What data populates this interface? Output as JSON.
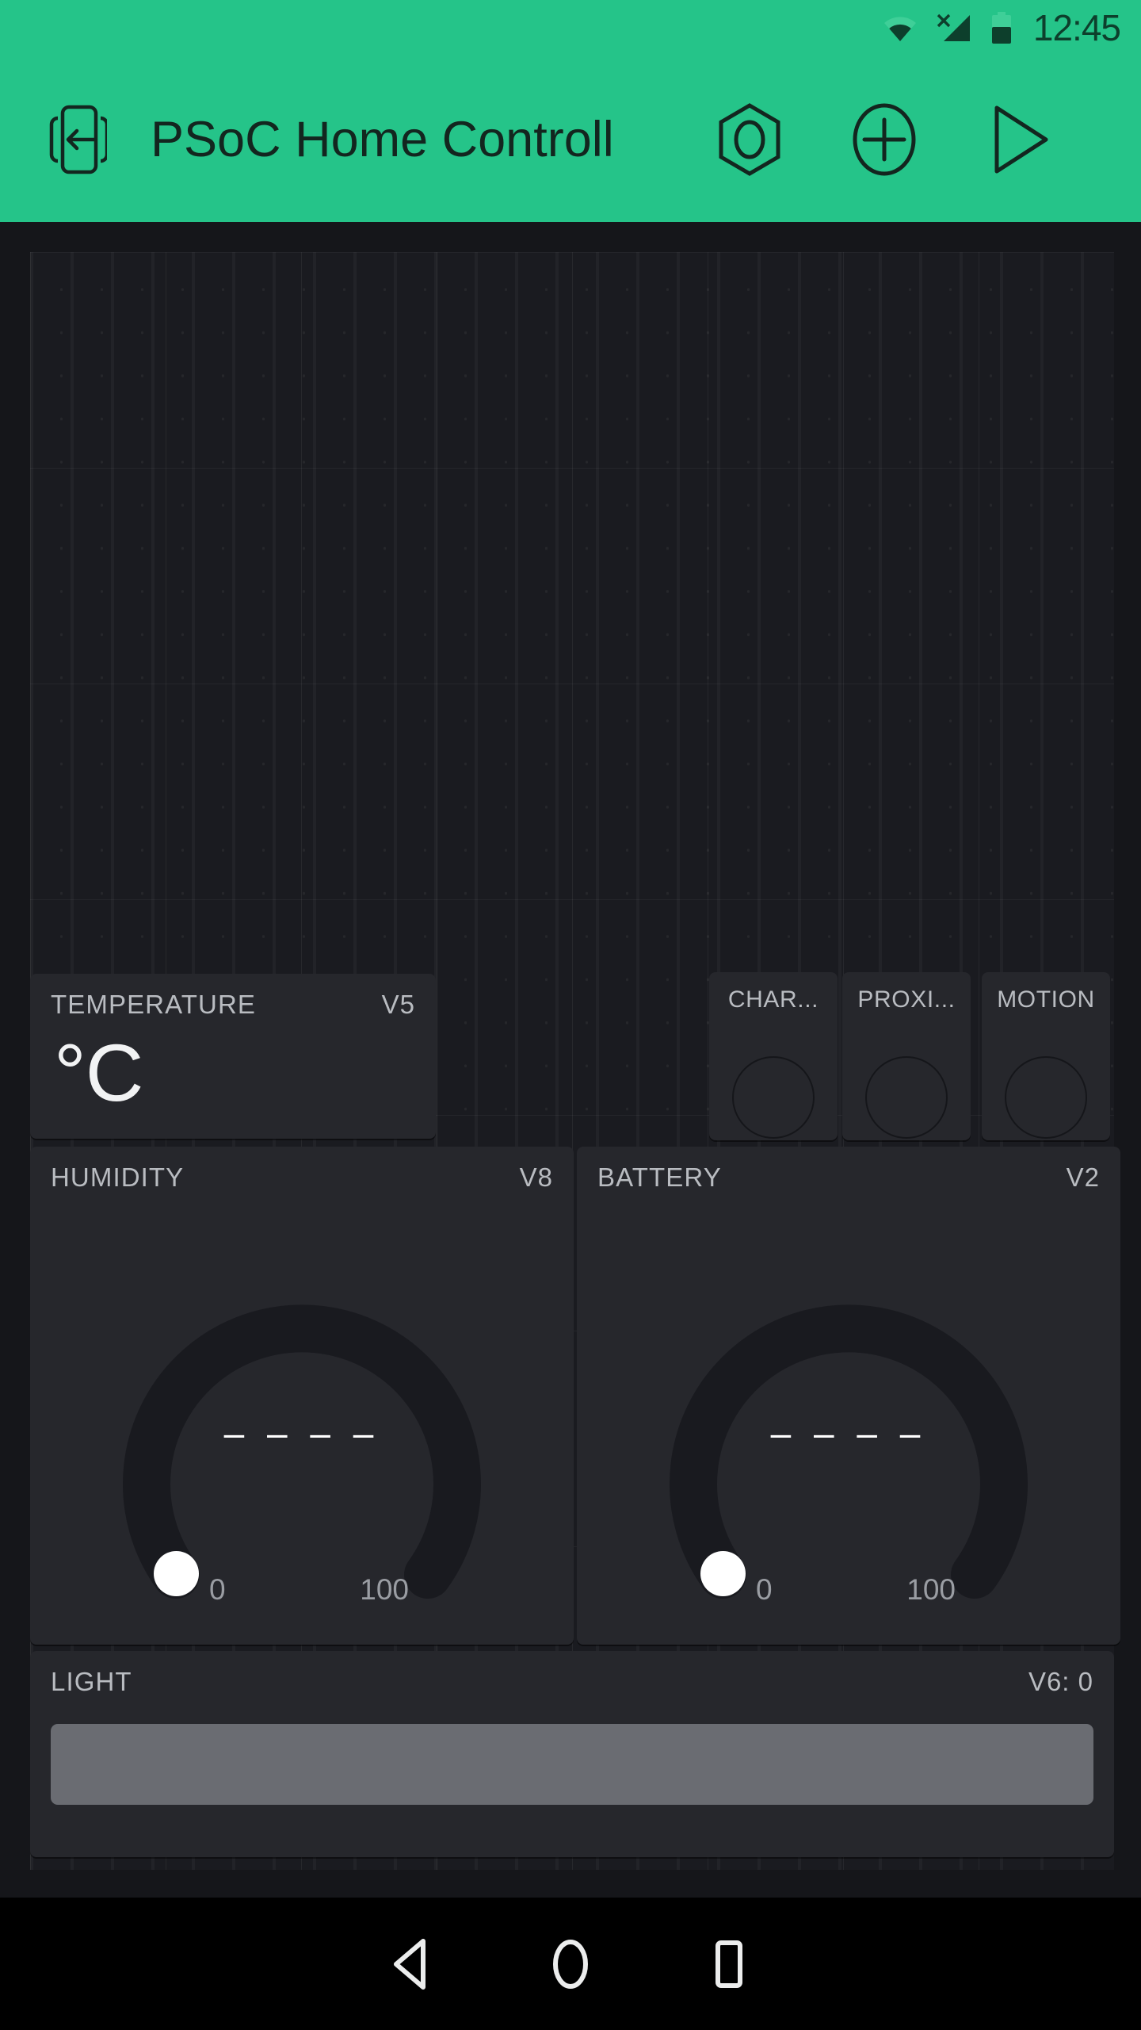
{
  "status_bar": {
    "time": "12:45",
    "icons": [
      "wifi-icon",
      "cellular-no-sim-icon",
      "battery-icon"
    ],
    "background_color": "#25c489",
    "foreground_color": "#0d3f2c"
  },
  "app_bar": {
    "title": "PSoC Home Controller",
    "title_truncated": "PSoC Home Controll",
    "background_color": "#25c489",
    "back_icon": "device-exit-icon",
    "actions": [
      {
        "name": "hexagon-settings-icon",
        "label": "Settings"
      },
      {
        "name": "plus-circle-icon",
        "label": "Add Widget"
      },
      {
        "name": "play-icon",
        "label": "Play"
      }
    ]
  },
  "dashboard": {
    "background_color": "#15161a",
    "grid_color": "#1a1b20",
    "widget_color": "#26272c",
    "widgets": {
      "temperature": {
        "label": "TEMPERATURE",
        "pin": "V5",
        "value": "°C"
      },
      "leds": [
        {
          "label": "CHAR...",
          "state": "off"
        },
        {
          "label": "PROXI...",
          "state": "off"
        },
        {
          "label": "MOTION",
          "state": "off"
        }
      ],
      "gauges": [
        {
          "label": "HUMIDITY",
          "pin": "V8",
          "value": "– – – –",
          "min": "0",
          "max": "100",
          "knob_position": 0
        },
        {
          "label": "BATTERY",
          "pin": "V2",
          "value": "– – – –",
          "min": "0",
          "max": "100",
          "knob_position": 0
        }
      ],
      "slider": {
        "label": "LIGHT",
        "pin_value": "V6: 0",
        "track_color": "#6a6c72",
        "value": 0
      }
    }
  },
  "nav_bar": {
    "background_color": "#000000",
    "buttons": [
      {
        "name": "nav-back-icon",
        "label": "Back"
      },
      {
        "name": "nav-home-icon",
        "label": "Home"
      },
      {
        "name": "nav-recents-icon",
        "label": "Recents"
      }
    ]
  }
}
